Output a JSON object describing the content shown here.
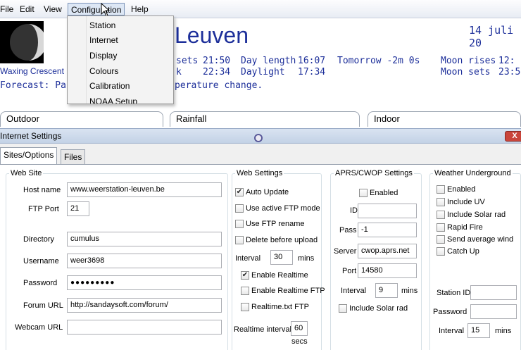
{
  "menu": {
    "items": [
      "File",
      "Edit",
      "View",
      "Configuration",
      "Help"
    ],
    "dropdown": [
      "Station",
      "Internet",
      "Display",
      "Colours",
      "Calibration",
      "NOAA Setup"
    ]
  },
  "station": {
    "city": "Leuven",
    "date": "14 juli 20",
    "moon_phase": "Waxing Crescent",
    "forecast_prefix": "Forecast:  Part",
    "forecast_suffix": "perature change.",
    "sunset_label": "sets",
    "sunset_value": "21:50",
    "dusk_label": "k",
    "dusk_value": "22:34",
    "day_length_label": "Day length",
    "day_length_value": "16:07",
    "daylight_label": "Daylight",
    "daylight_value": "17:34",
    "tomorrow": "Tomorrow -2m 0s",
    "moon_rises_label": "Moon rises",
    "moon_rises_value": "12:",
    "moon_sets_label": "Moon sets",
    "moon_sets_value": "23:5"
  },
  "sections": [
    "Outdoor",
    "Rainfall",
    "Indoor"
  ],
  "internet_settings": {
    "title": "Internet Settings",
    "close": "X",
    "tabs": [
      "Sites/Options",
      "Files"
    ],
    "website": {
      "legend": "Web Site",
      "host_label": "Host name",
      "host_value": "www.weerstation-leuven.be",
      "port_label": "FTP Port",
      "port_value": "21",
      "dir_label": "Directory",
      "dir_value": "cumulus",
      "user_label": "Username",
      "user_value": "weer3698",
      "pass_label": "Password",
      "pass_value": "●●●●●●●●●",
      "forum_label": "Forum URL",
      "forum_value": "http://sandaysoft.com/forum/",
      "webcam_label": "Webcam URL",
      "webcam_value": ""
    },
    "websettings": {
      "legend": "Web Settings",
      "auto_update": "Auto Update",
      "active_ftp": "Use active FTP mode",
      "ftp_rename": "Use FTP rename",
      "delete_before": "Delete before upload",
      "interval_label": "Interval",
      "interval_value": "30",
      "interval_unit": "mins",
      "enable_realtime": "Enable Realtime",
      "enable_realtime_ftp": "Enable Realtime FTP",
      "realtime_txt": "Realtime.txt FTP",
      "rt_interval_label": "Realtime interval",
      "rt_interval_value": "60",
      "rt_interval_unit": "secs"
    },
    "aprs": {
      "legend": "APRS/CWOP Settings",
      "enabled": "Enabled",
      "id_label": "ID",
      "id_value": "",
      "pass_label": "Pass",
      "pass_value": "-1",
      "server_label": "Server",
      "server_value": "cwop.aprs.net",
      "port_label": "Port",
      "port_value": "14580",
      "interval_label": "Interval",
      "interval_value": "9",
      "interval_unit": "mins",
      "solar": "Include Solar rad"
    },
    "wu": {
      "legend": "Weather Underground",
      "enabled": "Enabled",
      "uv": "Include UV",
      "solar": "Include Solar rad",
      "rapid": "Rapid Fire",
      "avg_wind": "Send average wind",
      "catch_up": "Catch Up",
      "station_label": "Station ID",
      "station_value": "",
      "password_label": "Password",
      "password_value": "",
      "interval_label": "Interval",
      "interval_value": "15",
      "interval_unit": "mins"
    }
  },
  "checks": {
    "checked": "✔"
  }
}
